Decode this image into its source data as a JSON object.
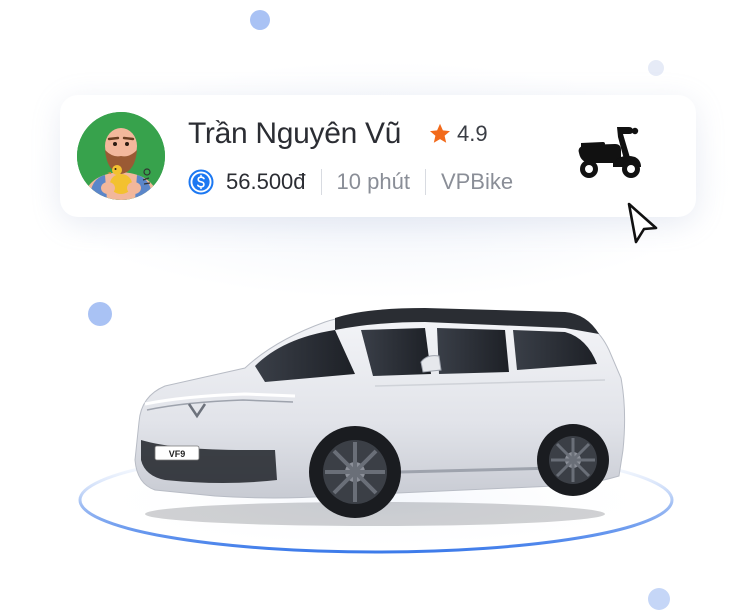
{
  "driver": {
    "name": "Trần Nguyên Vũ",
    "rating": "4.9",
    "price": "56.500đ",
    "eta": "10 phút",
    "service": "VPBike"
  },
  "car": {
    "plate": "VF9"
  },
  "icons": {
    "rating": "star-icon",
    "price": "dollar-coin-icon",
    "vehicle": "scooter-icon",
    "pointer": "cursor-icon"
  },
  "colors": {
    "star": "#f26a1b",
    "coin": "#1c78f2",
    "text_primary": "#2b2d33",
    "text_secondary": "#8a8e97",
    "accent_blue": "#a9c2f4",
    "platform_ring": "#3d7bea"
  }
}
